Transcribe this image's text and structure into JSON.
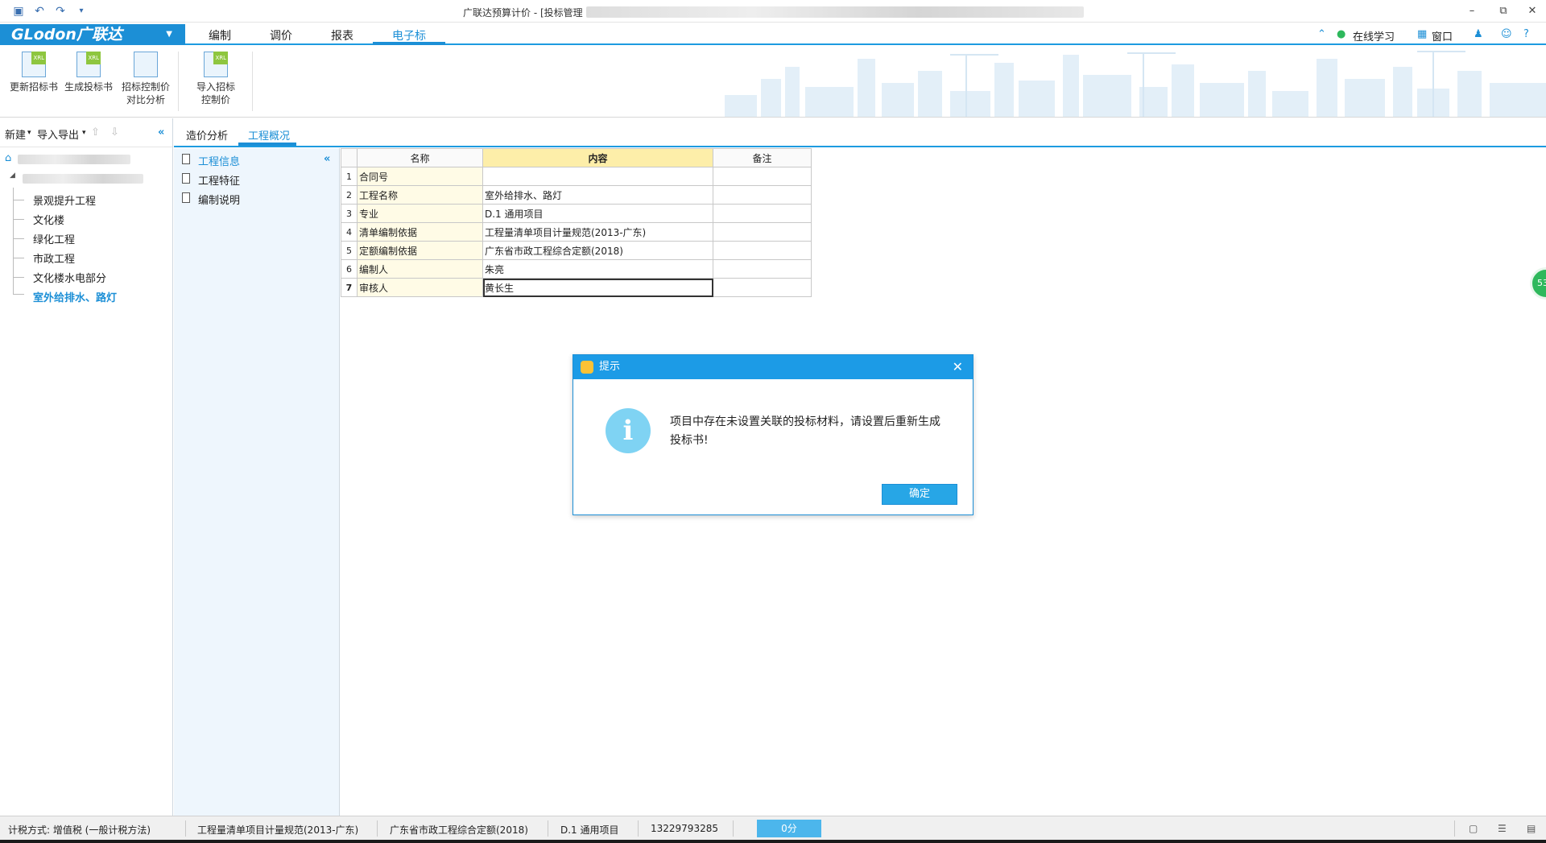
{
  "window": {
    "title": "广联达预算计价 - [投标管理",
    "controls": [
      "–",
      "⧉",
      "✕"
    ]
  },
  "menu": {
    "brand": "GLodon广联达",
    "items": [
      "编制",
      "调价",
      "报表",
      "电子标"
    ],
    "active": "电子标",
    "right": {
      "learn": "在线学习",
      "window": "窗口",
      "help": "?"
    }
  },
  "ribbon": {
    "buttons": [
      {
        "label1": "更新招标书",
        "label2": ""
      },
      {
        "label1": "生成投标书",
        "label2": ""
      },
      {
        "label1": "招标控制价",
        "label2": "对比分析"
      },
      {
        "label1": "导入招标",
        "label2": "控制价"
      }
    ],
    "icon_tag": "XRL"
  },
  "left": {
    "tools": {
      "new": "新建",
      "import_export": "导入导出"
    },
    "tree": [
      "景观提升工程",
      "文化楼",
      "绿化工程",
      "市政工程",
      "文化楼水电部分",
      "室外给排水、路灯"
    ]
  },
  "tabs": [
    "造价分析",
    "工程概况"
  ],
  "nav": [
    "工程信息",
    "工程特征",
    "编制说明"
  ],
  "grid": {
    "headers": [
      "名称",
      "内容",
      "备注"
    ],
    "rows": [
      {
        "n": "1",
        "name": "合同号",
        "content": "",
        "note": ""
      },
      {
        "n": "2",
        "name": "工程名称",
        "content": "室外给排水、路灯",
        "note": ""
      },
      {
        "n": "3",
        "name": "专业",
        "content": "D.1 通用项目",
        "note": ""
      },
      {
        "n": "4",
        "name": "清单编制依据",
        "content": "工程量清单项目计量规范(2013-广东)",
        "note": ""
      },
      {
        "n": "5",
        "name": "定额编制依据",
        "content": "广东省市政工程综合定额(2018)",
        "note": ""
      },
      {
        "n": "6",
        "name": "编制人",
        "content": "朱亮",
        "note": ""
      },
      {
        "n": "7",
        "name": "审核人",
        "content": "黄长生",
        "note": ""
      }
    ]
  },
  "dialog": {
    "title": "提示",
    "message": "项目中存在未设置关联的投标材料，请设置后重新生成投标书!",
    "ok": "确定"
  },
  "status": {
    "tax": "计税方式: 增值税 (一般计税方法)",
    "spec": "工程量清单项目计量规范(2013-广东)",
    "quota": "广东省市政工程综合定额(2018)",
    "major": "D.1 通用项目",
    "phone": "13229793285",
    "score": "0分"
  },
  "float_badge": "53"
}
